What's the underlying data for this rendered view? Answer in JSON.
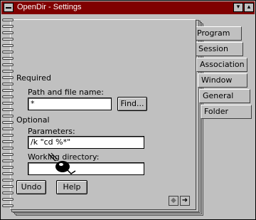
{
  "window": {
    "title": "OpenDir - Settings",
    "minimize_glyph": "▾",
    "maximize_glyph": "▴"
  },
  "sections": {
    "required": "Required",
    "optional": "Optional"
  },
  "fields": {
    "path_label": "Path and file name:",
    "path_value": "*",
    "parameters_label": "Parameters:",
    "parameters_value": "/k \"cd %*\"",
    "workdir_label": "Working directory:",
    "workdir_value": ""
  },
  "buttons": {
    "find": "Find...",
    "undo": "Undo",
    "help": "Help"
  },
  "tabs": [
    {
      "label": "Program"
    },
    {
      "label": "Session"
    },
    {
      "label": "Association"
    },
    {
      "label": "Window"
    },
    {
      "label": "General"
    },
    {
      "label": "Folder"
    }
  ],
  "nav": {
    "prev_glyph": "◆",
    "next_glyph": "➜"
  },
  "colors": {
    "titlebar": "#800000",
    "background": "#c0c0c0"
  }
}
